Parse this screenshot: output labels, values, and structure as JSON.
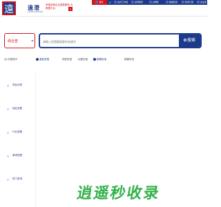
{
  "header": {
    "brand_mark": "遠",
    "brand_name": "遠澄",
    "brand_en": "LINKLINUVE",
    "slogan": "承接多种企业智能服务 大数据平台",
    "badge": "E"
  },
  "nav": {
    "home": "首页",
    "divider": "V",
    "items": [
      {
        "label": "会员工作组"
      },
      {
        "label": "运营概览"
      },
      {
        "label": "办网区"
      },
      {
        "label": "数据应用"
      },
      {
        "label": "新闻订阅"
      },
      {
        "label": "企业家"
      }
    ]
  },
  "search": {
    "type_selected": "综合查",
    "placeholder": "请输入您想要搜索的关键字",
    "button_label": "搜索"
  },
  "filters": [
    {
      "label": "热搜城市"
    },
    {
      "label": "重新查搜",
      "active": true
    },
    {
      "label": "按照查搜"
    },
    {
      "label": "标题查搜"
    },
    {
      "label": "精确查询",
      "active": true
    },
    {
      "label": "模糊查询"
    }
  ],
  "sidebar": {
    "items": [
      {
        "label": "项目分类"
      },
      {
        "label": "地区查看"
      },
      {
        "label": "行业查看"
      },
      {
        "label": "事项查看"
      },
      {
        "label": "热门查询"
      }
    ]
  },
  "watermark": "逍遥秒收录"
}
